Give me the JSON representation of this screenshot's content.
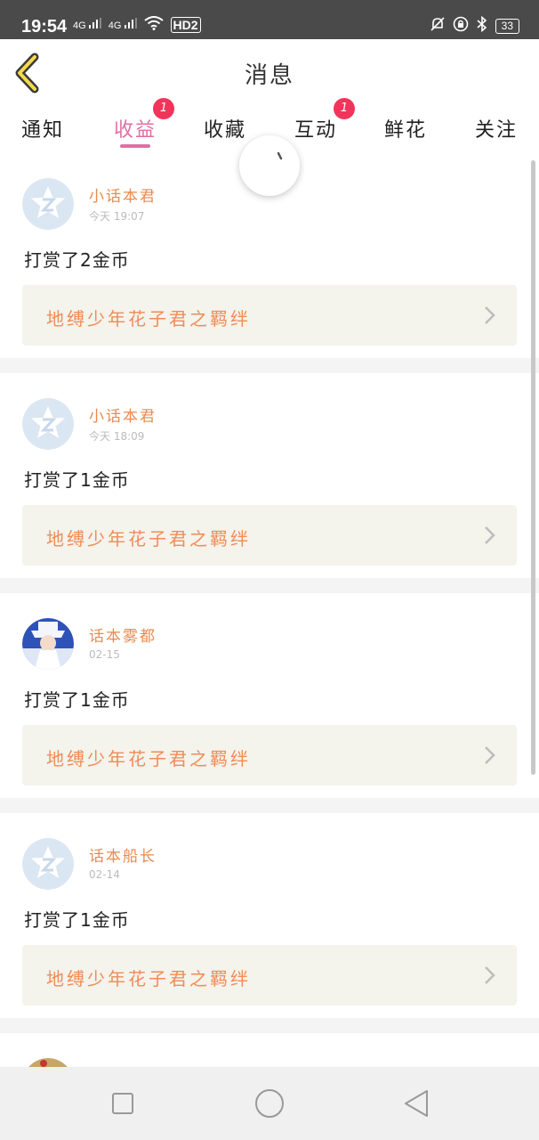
{
  "status_bar": {
    "time": "19:54",
    "signal_1": "4G",
    "signal_2": "4G",
    "hd": "HD2",
    "battery": "33"
  },
  "header": {
    "title": "消息",
    "back_icon": "chevron-left-icon"
  },
  "tabs": [
    {
      "label": "通知",
      "badge": ""
    },
    {
      "label": "收益",
      "badge": "1",
      "active": true
    },
    {
      "label": "收藏",
      "badge": ""
    },
    {
      "label": "互动",
      "badge": "1"
    },
    {
      "label": "鲜花",
      "badge": ""
    },
    {
      "label": "关注",
      "badge": ""
    }
  ],
  "messages": [
    {
      "user": "小话本君",
      "time": "今天 19:07",
      "text": "打赏了2金币",
      "link": "地缚少年花子君之羁绊",
      "avatar": "qq-default-avatar"
    },
    {
      "user": "小话本君",
      "time": "今天 18:09",
      "text": "打赏了1金币",
      "link": "地缚少年花子君之羁绊",
      "avatar": "qq-default-avatar"
    },
    {
      "user": "话本雾都",
      "time": "02-15",
      "text": "打赏了1金币",
      "link": "地缚少年花子君之羁绊",
      "avatar": "anime-character-avatar"
    },
    {
      "user": "话本船长",
      "time": "02-14",
      "text": "打赏了1金币",
      "link": "地缚少年花子君之羁绊",
      "avatar": "qq-default-avatar"
    }
  ],
  "colors": {
    "accent": "#e06fa4",
    "username": "#e98a4c",
    "link": "#f08c56",
    "badge": "#f2345b"
  }
}
